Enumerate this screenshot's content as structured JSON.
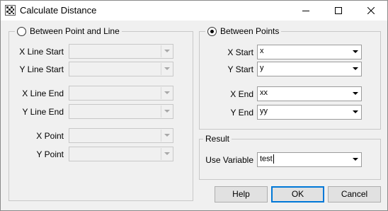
{
  "window": {
    "title": "Calculate Distance"
  },
  "point_line": {
    "legend": "Between Point and Line",
    "selected": false,
    "fields": [
      {
        "label": "X Line Start",
        "value": ""
      },
      {
        "label": "Y Line Start",
        "value": ""
      },
      {
        "label": "X Line End",
        "value": ""
      },
      {
        "label": "Y Line End",
        "value": ""
      },
      {
        "label": "X Point",
        "value": ""
      },
      {
        "label": "Y Point",
        "value": ""
      }
    ]
  },
  "points": {
    "legend": "Between Points",
    "selected": true,
    "fields": [
      {
        "label": "X Start",
        "value": "x"
      },
      {
        "label": "Y Start",
        "value": "y"
      },
      {
        "label": "X End",
        "value": "xx"
      },
      {
        "label": "Y End",
        "value": "yy"
      }
    ]
  },
  "result": {
    "legend": "Result",
    "label": "Use Variable",
    "value": "test"
  },
  "buttons": {
    "help": "Help",
    "ok": "OK",
    "cancel": "Cancel"
  },
  "colors": {
    "default_button_border": "#0078d7",
    "window_bg": "#f0f0f0"
  }
}
